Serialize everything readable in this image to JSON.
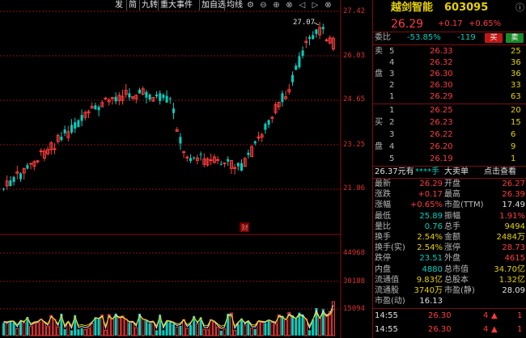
{
  "toolbar": {
    "items": [
      "发",
      "简",
      "九转",
      "重大事件",
      "加自选",
      "均线"
    ]
  },
  "price_axis": [
    "27.42",
    "26.03",
    "24.65",
    "23.25",
    "21.86"
  ],
  "volume_axis": [
    "44968",
    "30188",
    "15094"
  ],
  "chart": {
    "high_label": "27.07",
    "event_marker": "财"
  },
  "stock": {
    "name": "越剑智能",
    "code": "603095",
    "price": "26.29",
    "change": "+0.17",
    "change_pct": "+0.65%"
  },
  "weibi": {
    "label": "委比",
    "pct": "-53.85%",
    "diff": "-119",
    "buy_btn": "买",
    "sell_btn": "卖"
  },
  "asks": [
    {
      "side": "卖",
      "level": "5",
      "price": "26.33",
      "vol": "25"
    },
    {
      "side": "",
      "level": "4",
      "price": "26.32",
      "vol": "36"
    },
    {
      "side": "盘",
      "level": "3",
      "price": "26.30",
      "vol": "36"
    },
    {
      "side": "",
      "level": "2",
      "price": "26.30",
      "vol": "33"
    },
    {
      "side": "",
      "level": "1",
      "price": "26.29",
      "vol": "63"
    }
  ],
  "bids": [
    {
      "side": "",
      "level": "1",
      "price": "26.25",
      "vol": "20"
    },
    {
      "side": "买",
      "level": "2",
      "price": "26.23",
      "vol": "15"
    },
    {
      "side": "",
      "level": "3",
      "price": "26.22",
      "vol": "6"
    },
    {
      "side": "盘",
      "level": "4",
      "price": "26.20",
      "vol": "9"
    },
    {
      "side": "",
      "level": "5",
      "price": "26.19",
      "vol": "1"
    }
  ],
  "deal": {
    "price_text": "26.37元有",
    "stars": "****手",
    "big": "大卖单",
    "link": "点击查看"
  },
  "stats": [
    {
      "l1": "最新",
      "v1": "26.29",
      "c1": "red",
      "l2": "开盘",
      "v2": "26.27",
      "c2": "red"
    },
    {
      "l1": "涨跌",
      "v1": "+0.17",
      "c1": "red",
      "l2": "最高",
      "v2": "26.39",
      "c2": "red"
    },
    {
      "l1": "涨幅",
      "v1": "+0.65%",
      "c1": "red",
      "l2": "市盈(TTM)",
      "v2": "17.49",
      "c2": "wht"
    },
    {
      "l1": "最低",
      "v1": "25.89",
      "c1": "green",
      "l2": "振幅",
      "v2": "1.91%",
      "c2": "red"
    },
    {
      "l1": "量比",
      "v1": "0.76",
      "c1": "green",
      "l2": "总手",
      "v2": "9494",
      "c2": "yel"
    },
    {
      "l1": "换手",
      "v1": "2.54%",
      "c1": "yel",
      "l2": "金额",
      "v2": "2484万",
      "c2": "yel"
    },
    {
      "l1": "换手(实)",
      "v1": "2.54%",
      "c1": "yel",
      "l2": "涨停",
      "v2": "28.73",
      "c2": "red"
    },
    {
      "l1": "跌停",
      "v1": "23.51",
      "c1": "green",
      "l2": "外盘",
      "v2": "4615",
      "c2": "red"
    },
    {
      "l1": "内盘",
      "v1": "4880",
      "c1": "green",
      "l2": "总市值",
      "v2": "34.70亿",
      "c2": "yel"
    },
    {
      "l1": "流通值",
      "v1": "9.83亿",
      "c1": "yel",
      "l2": "总股本",
      "v2": "1.32亿",
      "c2": "yel"
    },
    {
      "l1": "流通股",
      "v1": "3740万",
      "c1": "yel",
      "l2": "市盈(静)",
      "v2": "28.09",
      "c2": "wht"
    },
    {
      "l1": "市盈(动)",
      "v1": "16.13",
      "c1": "wht",
      "l2": "",
      "v2": "",
      "c2": "wht"
    }
  ],
  "ticks": [
    {
      "time": "14:55",
      "price": "26.30",
      "vol": "4",
      "dir": "up",
      "n": "1"
    },
    {
      "time": "14:55",
      "price": "26.30",
      "vol": "4",
      "dir": "up",
      "n": "1"
    }
  ],
  "colors": {
    "up": "#ff3c3c",
    "down": "#00d0c0",
    "grid": "#8a1010",
    "ma5": "#e8e8e8",
    "ma10": "#e6d200"
  }
}
